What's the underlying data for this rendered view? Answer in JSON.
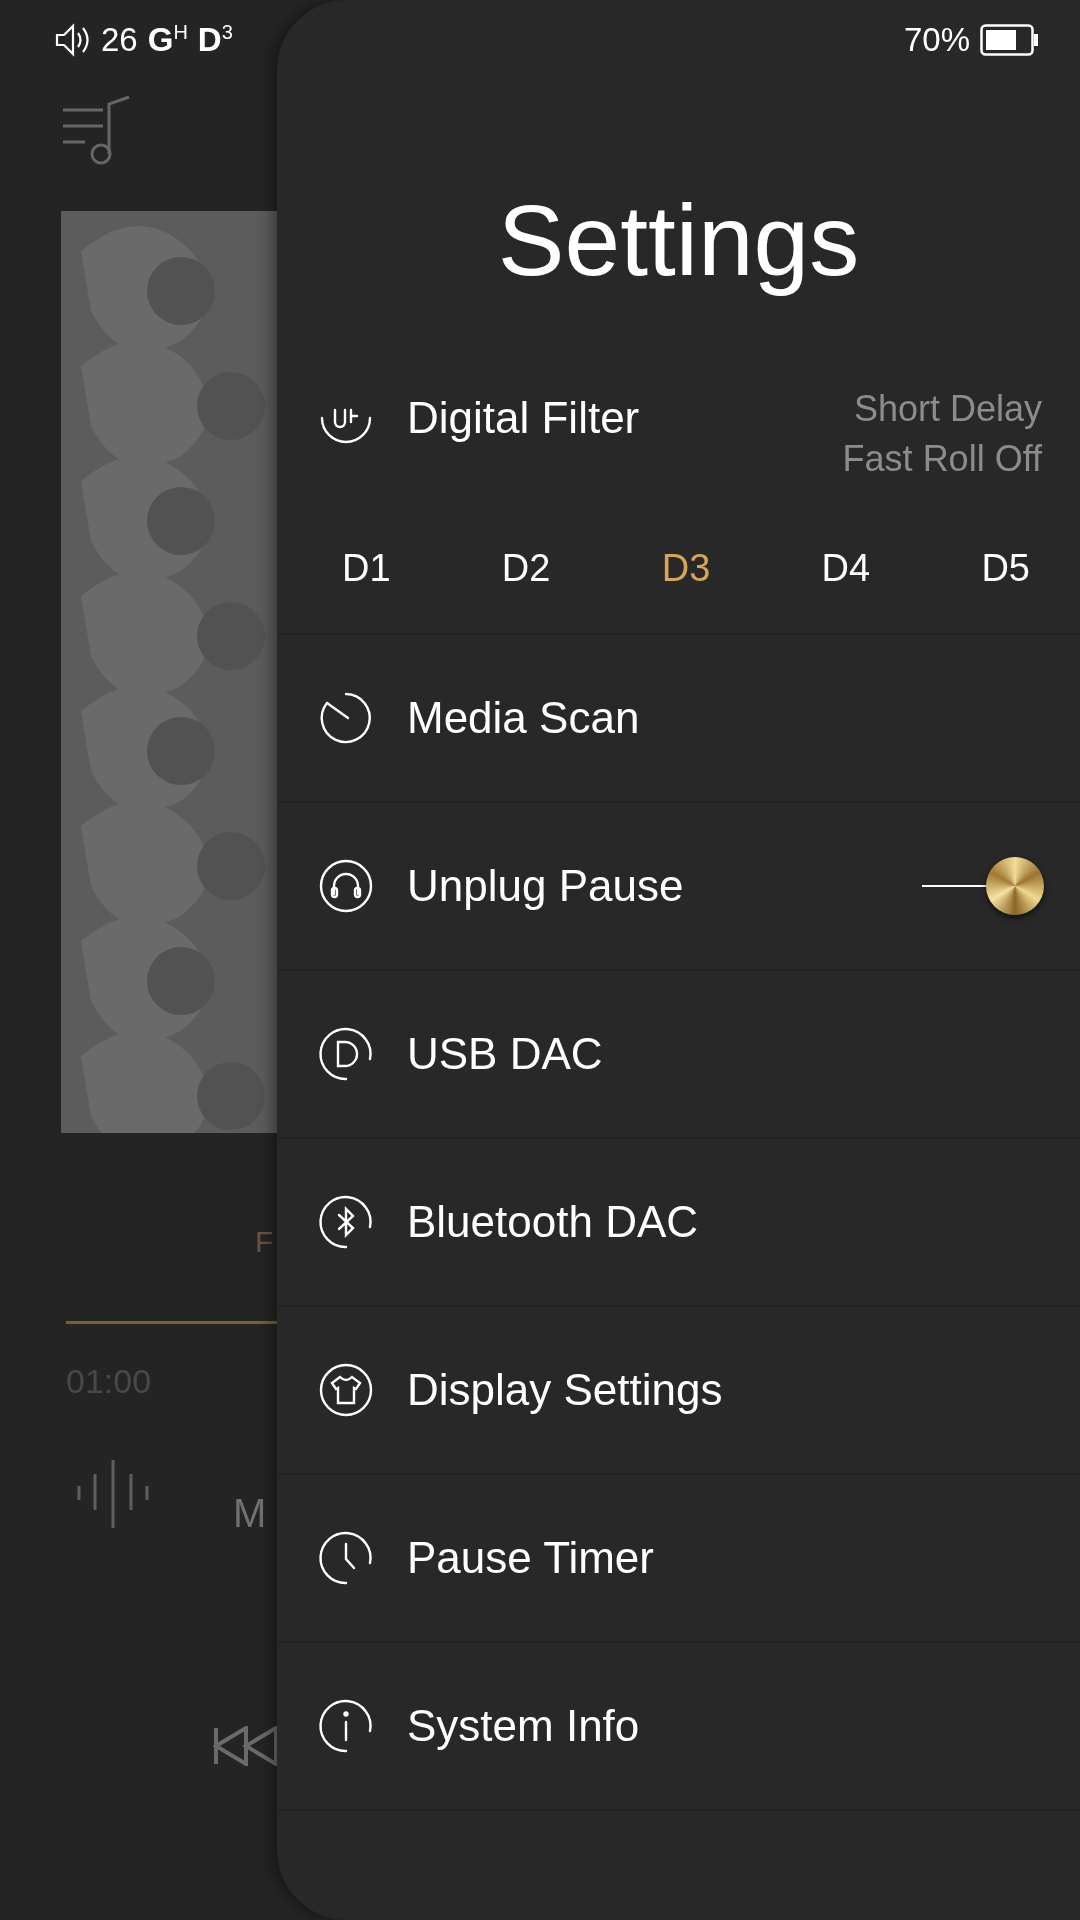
{
  "status_bar": {
    "volume": "26",
    "gain": "G$^{H}$",
    "dac": "D$^{3}$",
    "battery": "70%"
  },
  "player": {
    "format": "F",
    "time": "01:00",
    "title": "M"
  },
  "settings": {
    "title": "Settings",
    "items": [
      {
        "kind": "filter",
        "label": "Digital Filter",
        "values": [
          "Short Delay",
          "Fast Roll Off"
        ],
        "options": [
          {
            "label": "D1",
            "selected": false
          },
          {
            "label": "D2",
            "selected": false
          },
          {
            "label": "D3",
            "selected": true
          },
          {
            "label": "D4",
            "selected": false
          },
          {
            "label": "D5",
            "selected": false
          }
        ]
      },
      {
        "kind": "link",
        "label": "Media Scan"
      },
      {
        "kind": "toggle",
        "label": "Unplug Pause",
        "on": true
      },
      {
        "kind": "link",
        "label": "USB DAC"
      },
      {
        "kind": "link",
        "label": "Bluetooth DAC"
      },
      {
        "kind": "link",
        "label": "Display Settings"
      },
      {
        "kind": "link",
        "label": "Pause Timer"
      },
      {
        "kind": "link",
        "label": "System Info"
      }
    ]
  }
}
